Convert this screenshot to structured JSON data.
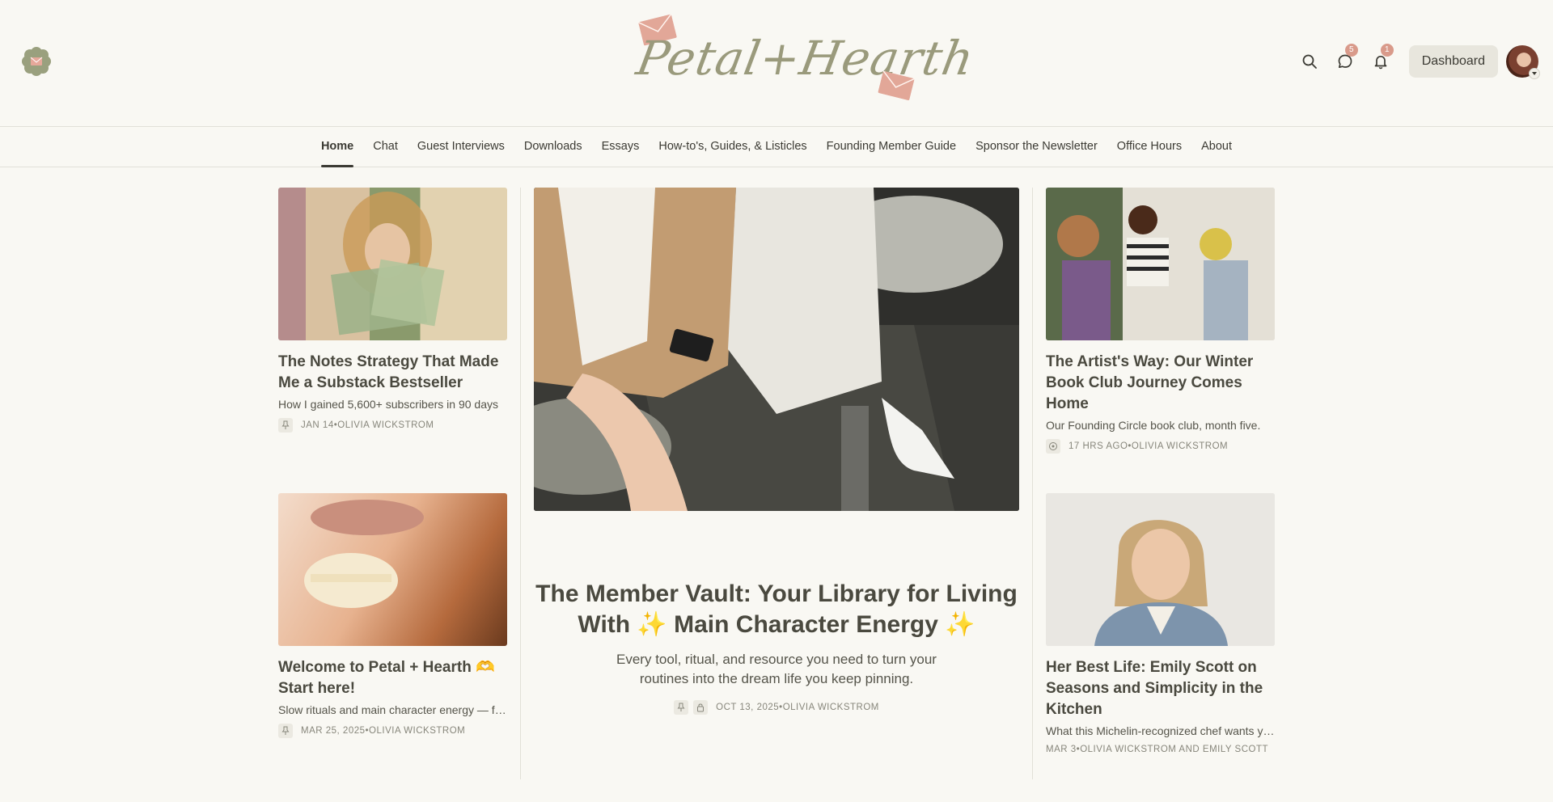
{
  "header": {
    "logo_text": "Petal+Hearth",
    "messages_badge": "5",
    "notifications_badge": "1",
    "dashboard_label": "Dashboard"
  },
  "nav": {
    "items": [
      "Home",
      "Chat",
      "Guest Interviews",
      "Downloads",
      "Essays",
      "How-to's, Guides, & Listicles",
      "Founding Member Guide",
      "Sponsor the Newsletter",
      "Office Hours",
      "About"
    ],
    "active": "Home"
  },
  "posts": {
    "left1": {
      "title": "The Notes Strategy That Made Me a Substack Bestseller",
      "subtitle": "How I gained 5,600+ subscribers in 90 days",
      "date": "JAN 14",
      "author": "OLIVIA WICKSTROM"
    },
    "left2": {
      "title": "Welcome to Petal + Hearth 🫶 Start here!",
      "subtitle": "Slow rituals and main character energy — for the woman who wants more",
      "date": "MAR 25, 2025",
      "author": "OLIVIA WICKSTROM"
    },
    "feature": {
      "title": "The Member Vault: Your Library for Living With ✨ Main Character Energy ✨",
      "subtitle": "Every tool, ritual, and resource you need to turn your routines into the dream life you keep pinning.",
      "date": "OCT 13, 2025",
      "author": "OLIVIA WICKSTROM"
    },
    "right1": {
      "title": "The Artist's Way: Our Winter Book Club Journey Comes Home",
      "subtitle": "Our Founding Circle book club, month five.",
      "date": "17 HRS AGO",
      "author": "OLIVIA WICKSTROM"
    },
    "right2": {
      "title": "Her Best Life: Emily Scott on Seasons and Simplicity in the Kitchen",
      "subtitle": "What this Michelin-recognized chef wants you to know",
      "date": "MAR 3",
      "author": "OLIVIA WICKSTROM AND EMILY SCOTT"
    }
  },
  "meta_separator": " • ",
  "colors": {
    "background": "#f9f8f3",
    "accent": "#d99a8a",
    "logo": "#9a9a7c",
    "text": "#3b3a33"
  }
}
